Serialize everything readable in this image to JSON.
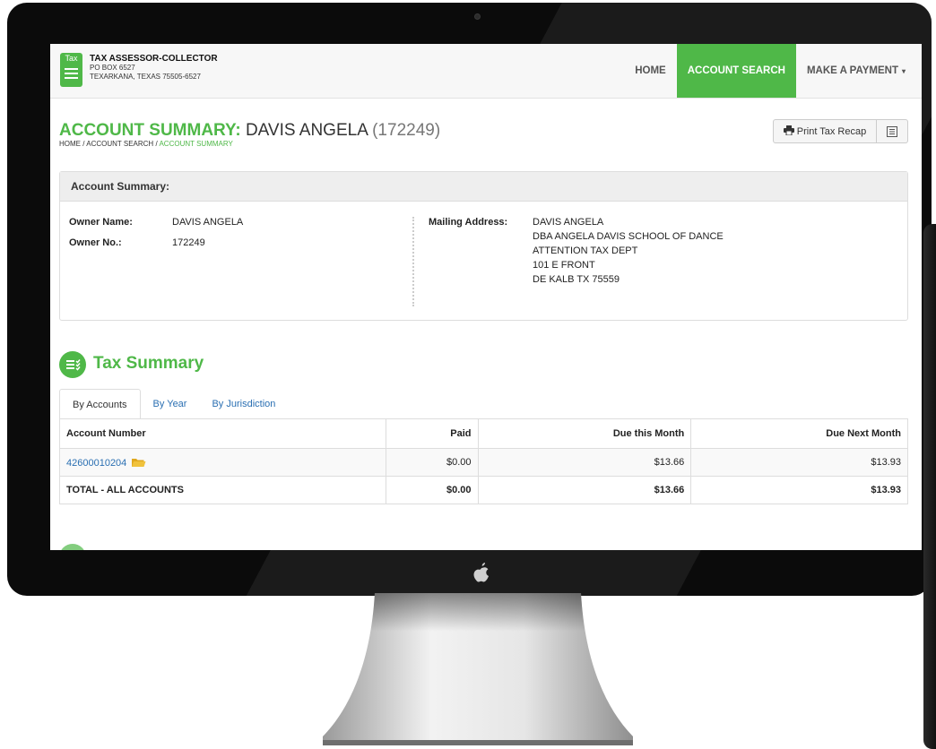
{
  "header": {
    "logo_text": "Tax",
    "org_name": "TAX ASSESSOR-COLLECTOR",
    "address_line1": "PO BOX 6527",
    "address_line2": "TEXARKANA, TEXAS 75505-6527"
  },
  "nav": {
    "home": "HOME",
    "account_search": "ACCOUNT SEARCH",
    "make_payment": "MAKE A PAYMENT",
    "caret": "▾"
  },
  "page": {
    "title_prefix": "ACCOUNT SUMMARY:",
    "title_name": "DAVIS ANGELA",
    "title_number": "(172249)",
    "breadcrumb_home": "HOME",
    "breadcrumb_sep": " / ",
    "breadcrumb_search": "ACCOUNT SEARCH",
    "breadcrumb_current": "ACCOUNT SUMMARY",
    "print_button": "Print Tax Recap"
  },
  "account_summary": {
    "heading": "Account Summary:",
    "owner_name_label": "Owner Name:",
    "owner_name": "DAVIS ANGELA",
    "owner_no_label": "Owner No.:",
    "owner_no": "172249",
    "mailing_label": "Mailing Address:",
    "mailing_lines": [
      "DAVIS ANGELA",
      "DBA ANGELA DAVIS SCHOOL OF DANCE",
      "ATTENTION TAX DEPT",
      "101 E FRONT",
      "DE KALB TX 75559"
    ]
  },
  "tax_summary": {
    "heading": "Tax Summary",
    "tabs": [
      "By Accounts",
      "By Year",
      "By Jurisdiction"
    ],
    "columns": [
      "Account Number",
      "Paid",
      "Due this Month",
      "Due Next Month"
    ],
    "rows": [
      {
        "account": "42600010204",
        "paid": "$0.00",
        "due_this_month": "$13.66",
        "due_next_month": "$13.93"
      }
    ],
    "total": {
      "label": "TOTAL - ALL ACCOUNTS",
      "paid": "$0.00",
      "due_this_month": "$13.66",
      "due_next_month": "$13.93"
    }
  },
  "colors": {
    "brand_green": "#4fb848",
    "link_blue": "#2a6fb2",
    "folder_yellow": "#f0c23c"
  }
}
